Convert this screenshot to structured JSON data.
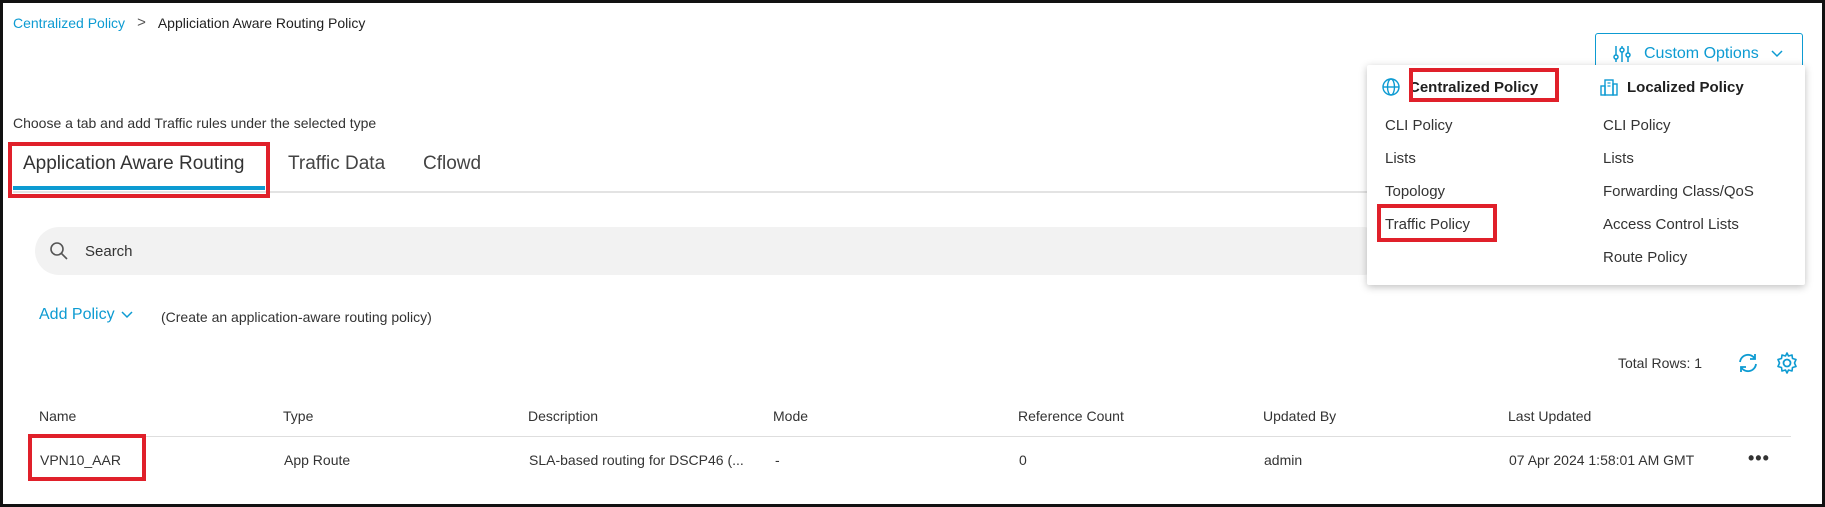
{
  "breadcrumb": {
    "parent": "Centralized Policy",
    "separator": ">",
    "current": "Appliciation Aware Routing Policy"
  },
  "hint": "Choose a tab and add Traffic rules under the selected type",
  "tabs": [
    {
      "label": "Application Aware Routing",
      "active": true
    },
    {
      "label": "Traffic Data",
      "active": false
    },
    {
      "label": "Cflowd",
      "active": false
    }
  ],
  "search": {
    "placeholder": "Search"
  },
  "add_policy": {
    "label": "Add Policy",
    "note": "(Create an application-aware routing policy)"
  },
  "total_rows": "Total Rows: 1",
  "table": {
    "headers": [
      "Name",
      "Type",
      "Description",
      "Mode",
      "Reference Count",
      "Updated By",
      "Last Updated"
    ],
    "rows": [
      {
        "name": "VPN10_AAR",
        "type": "App Route",
        "description": "SLA-based routing for DSCP46 (...",
        "mode": "-",
        "reference_count": "0",
        "updated_by": "admin",
        "last_updated": "07 Apr 2024 1:58:01 AM GMT",
        "more": "•••"
      }
    ]
  },
  "custom_options": {
    "label": "Custom Options",
    "centralized": {
      "title": "Centralized Policy",
      "items": [
        "CLI Policy",
        "Lists",
        "Topology",
        "Traffic Policy"
      ]
    },
    "localized": {
      "title": "Localized Policy",
      "items": [
        "CLI Policy",
        "Lists",
        "Forwarding Class/QoS",
        "Access Control Lists",
        "Route Policy"
      ]
    }
  },
  "colors": {
    "accent": "#0d9bd2",
    "highlight": "#e0202a"
  }
}
